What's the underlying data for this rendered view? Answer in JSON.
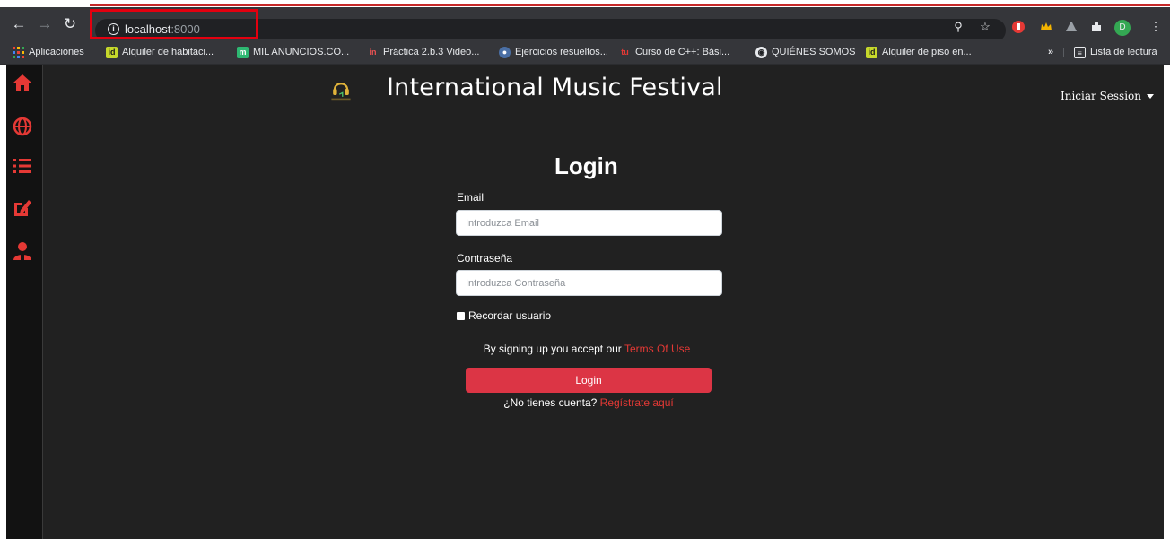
{
  "browser": {
    "url_host": "localhost",
    "url_port": ":8000",
    "profile_initial": "D",
    "bookmarks": [
      {
        "label": "Aplicaciones",
        "icon": "apps-grid-icon"
      },
      {
        "label": "Alquiler de habitaci...",
        "icon": "idealista-icon"
      },
      {
        "label": "MIL ANUNCIOS.CO...",
        "icon": "milanuncios-icon"
      },
      {
        "label": "Práctica 2.b.3 Video...",
        "icon": "udemy-icon"
      },
      {
        "label": "Ejercicios resueltos...",
        "icon": "chat-bubble-icon"
      },
      {
        "label": "Curso de C++: Bási...",
        "icon": "tutorial-icon"
      },
      {
        "label": "QUIÉNES SOMOS",
        "icon": "globe-dark-icon"
      },
      {
        "label": "Alquiler de piso en...",
        "icon": "idealista-icon"
      }
    ],
    "overflow_label": "»",
    "reading_list_label": "Lista de lectura"
  },
  "sidebar": {
    "items": [
      {
        "icon": "home-icon"
      },
      {
        "icon": "globe-icon"
      },
      {
        "icon": "list-icon"
      },
      {
        "icon": "edit-icon"
      },
      {
        "icon": "user-icon"
      }
    ]
  },
  "header": {
    "title": "International Music Festival",
    "menu_label": "Iniciar Session"
  },
  "login_form": {
    "title": "Login",
    "email_label": "Email",
    "email_placeholder": "Introduzca Email",
    "password_label": "Contraseña",
    "password_placeholder": "Introduzca Contraseña",
    "remember_label": "Recordar usuario",
    "terms_prefix": "By signing up you accept our",
    "terms_link": "Terms Of Use",
    "submit_label": "Login",
    "register_prefix": "¿No tienes cuenta?",
    "register_link": "Regístrate aquí"
  },
  "colors": {
    "accent": "#dc3545",
    "link": "#e53935",
    "background": "#212121",
    "sidebar_icon": "#e53935"
  }
}
